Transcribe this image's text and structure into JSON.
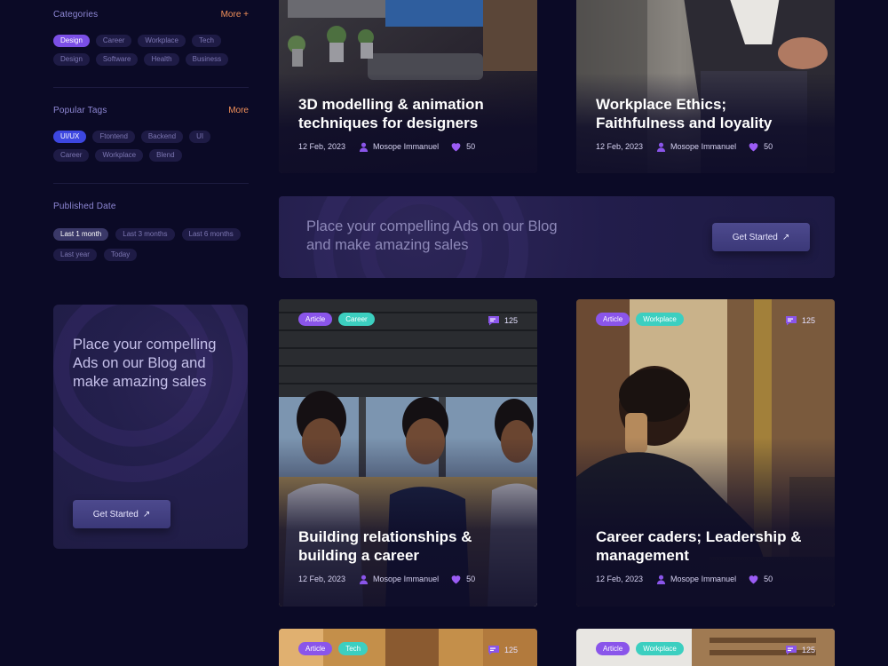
{
  "sidebar": {
    "categories": {
      "title": "Categories",
      "more": "More +",
      "chips": [
        "Design",
        "Career",
        "Workplace",
        "Tech",
        "Design",
        "Software",
        "Health",
        "Business"
      ]
    },
    "popular_tags": {
      "title": "Popular Tags",
      "more": "More",
      "chips": [
        "UI/UX",
        "Ftontend",
        "Backend",
        "UI",
        "Career",
        "Workplace",
        "Blend"
      ]
    },
    "published_date": {
      "title": "Published Date",
      "chips": [
        "Last 1 month",
        "Last 3 months",
        "Last 6 months",
        "Last year",
        "Today"
      ]
    },
    "ad": {
      "text": "Place your compelling Ads on our Blog and make amazing sales",
      "button": "Get Started"
    }
  },
  "wide_ad": {
    "text": "Place your compelling Ads on our Blog and make amazing sales",
    "button": "Get Started"
  },
  "cards": [
    {
      "title": "3D modelling & animation techniques for designers",
      "date": "12 Feb, 2023",
      "author": "Mosope Immanuel",
      "likes": "50"
    },
    {
      "title": "Workplace Ethics; Faithfulness and loyality",
      "date": "12 Feb, 2023",
      "author": "Mosope Immanuel",
      "likes": "50"
    },
    {
      "title": "Building relationships & building a career",
      "date": "12 Feb, 2023",
      "author": "Mosope Immanuel",
      "likes": "50",
      "tags": [
        "Article",
        "Career"
      ],
      "comments": "125"
    },
    {
      "title": "Career caders; Leadership & management",
      "date": "12 Feb, 2023",
      "author": "Mosope Immanuel",
      "likes": "50",
      "tags": [
        "Article",
        "Workplace"
      ],
      "comments": "125"
    },
    {
      "tags": [
        "Article",
        "Tech"
      ],
      "comments": "125"
    },
    {
      "tags": [
        "Article",
        "Workplace"
      ],
      "comments": "125"
    }
  ],
  "colors": {
    "background": "#0b0a26",
    "accent_orange": "#f3915a",
    "tag_purple": "#8a55ea",
    "tag_teal": "#3ccfc0",
    "heart": "#9b5cf5"
  },
  "icons": [
    "user-icon",
    "heart-icon",
    "comment-icon",
    "arrow-up-right-icon"
  ]
}
